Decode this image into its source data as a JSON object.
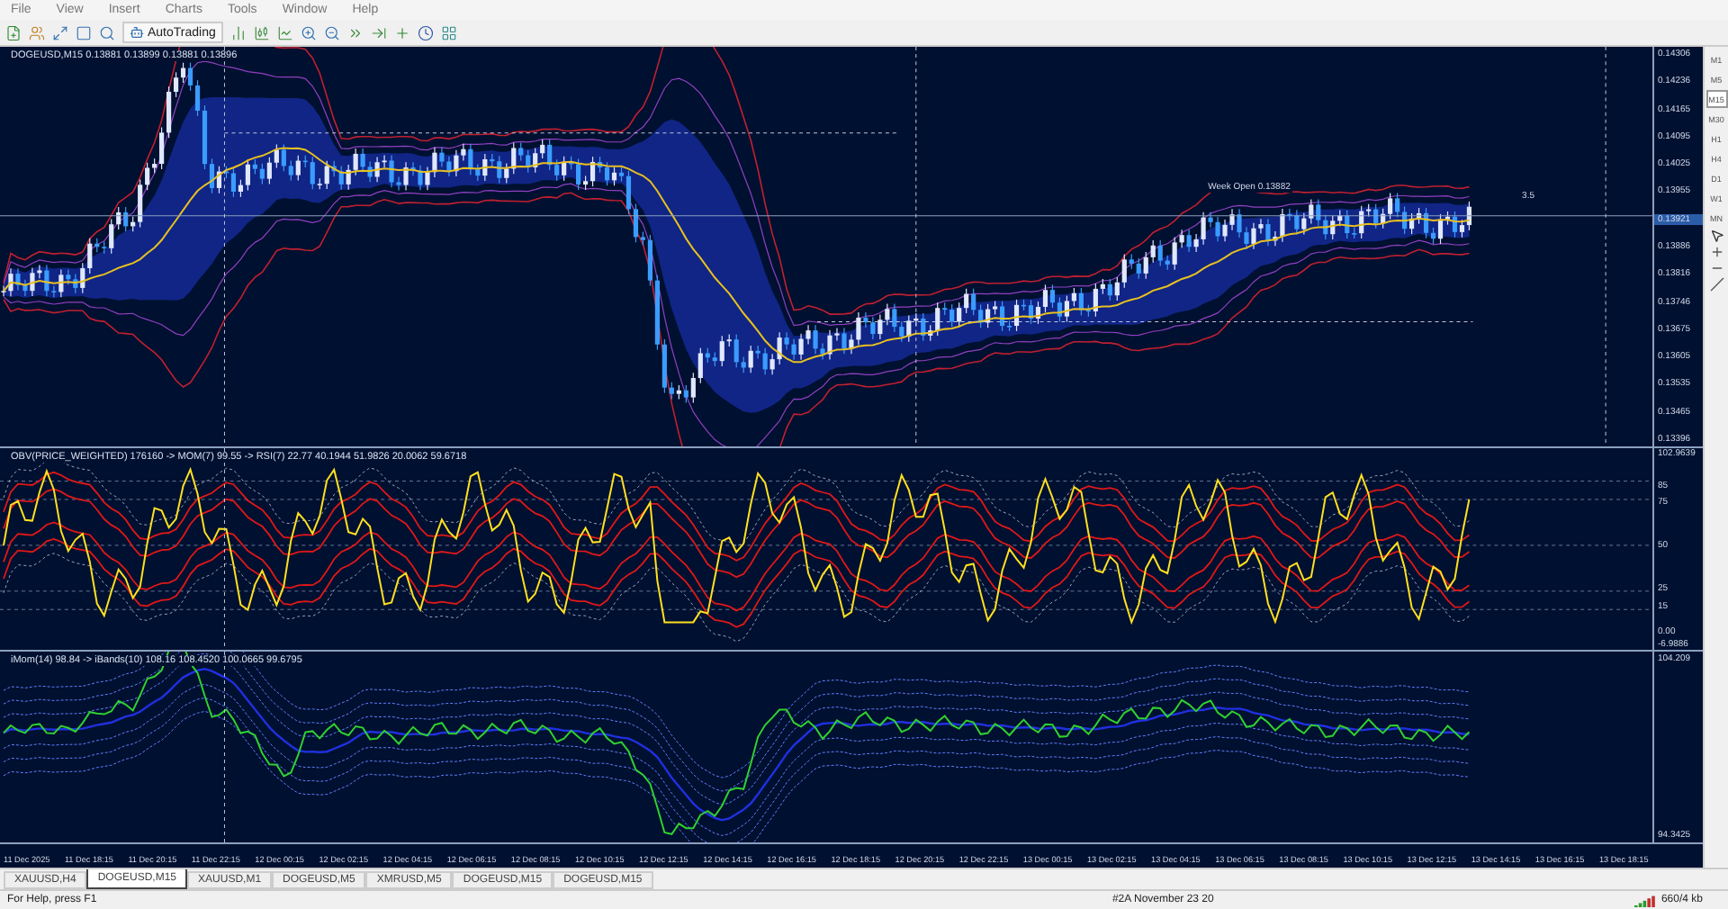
{
  "menu": [
    "File",
    "View",
    "Insert",
    "Charts",
    "Tools",
    "Window",
    "Help"
  ],
  "toolbar": {
    "autotrading": "AutoTrading"
  },
  "main_chart": {
    "header": "DOGEUSD,M15  0.13881 0.13899 0.13881 0.13896",
    "week_open_label": "Week Open 0.13882",
    "level_label": "3.5",
    "price_axis": [
      {
        "label": "0.14306",
        "kind": "tick"
      },
      {
        "label": "0.14236",
        "kind": "tick"
      },
      {
        "label": "0.14165",
        "kind": "tick"
      },
      {
        "label": "0.14095",
        "kind": "tick"
      },
      {
        "label": "0.14025",
        "kind": "tick"
      },
      {
        "label": "0.13955",
        "kind": "tick"
      },
      {
        "label": "0.13921",
        "kind": "current"
      },
      {
        "label": "0.13886",
        "kind": "tick"
      },
      {
        "label": "0.13816",
        "kind": "tick"
      },
      {
        "label": "0.13746",
        "kind": "tick"
      },
      {
        "label": "0.13675",
        "kind": "tick"
      },
      {
        "label": "0.13605",
        "kind": "tick"
      },
      {
        "label": "0.13535",
        "kind": "tick"
      },
      {
        "label": "0.13465",
        "kind": "tick"
      },
      {
        "label": "0.13396",
        "kind": "tick"
      }
    ]
  },
  "oscillator_pane": {
    "header": "OBV(PRICE_WEIGHTED) 176160 -> MOM(7) 99.55 -> RSI(7) 22.77  40.1944 51.9826 20.0062 59.6718",
    "axis": [
      "102.9639",
      "85",
      "75",
      "50",
      "25",
      "15",
      "0.00",
      "-6.9886"
    ]
  },
  "momentum_pane": {
    "header": "iMom(14) 98.84 -> iBands(10) 108.16  108.4520 100.0665 99.6795",
    "axis": [
      "104.209",
      "94.3425"
    ]
  },
  "time_axis": [
    "11 Dec 2025",
    "11 Dec 18:15",
    "11 Dec 20:15",
    "11 Dec 22:15",
    "12 Dec 00:15",
    "12 Dec 02:15",
    "12 Dec 04:15",
    "12 Dec 06:15",
    "12 Dec 08:15",
    "12 Dec 10:15",
    "12 Dec 12:15",
    "12 Dec 14:15",
    "12 Dec 16:15",
    "12 Dec 18:15",
    "12 Dec 20:15",
    "12 Dec 22:15",
    "13 Dec 00:15",
    "13 Dec 02:15",
    "13 Dec 04:15",
    "13 Dec 06:15",
    "13 Dec 08:15",
    "13 Dec 10:15",
    "13 Dec 12:15",
    "13 Dec 14:15",
    "13 Dec 16:15",
    "13 Dec 18:15"
  ],
  "timeframes": [
    {
      "label": "M1",
      "selected": false
    },
    {
      "label": "M5",
      "selected": false
    },
    {
      "label": "M15",
      "selected": true
    },
    {
      "label": "M30",
      "selected": false
    },
    {
      "label": "H1",
      "selected": false
    },
    {
      "label": "H4",
      "selected": false
    },
    {
      "label": "D1",
      "selected": false
    },
    {
      "label": "W1",
      "selected": false
    },
    {
      "label": "MN",
      "selected": false
    }
  ],
  "tabs": [
    {
      "label": "XAUUSD,H4",
      "selected": false
    },
    {
      "label": "DOGEUSD,M15",
      "selected": true
    },
    {
      "label": "XAUUSD,M1",
      "selected": false
    },
    {
      "label": "DOGEUSD,M5",
      "selected": false
    },
    {
      "label": "XMRUSD,M5",
      "selected": false
    },
    {
      "label": "DOGEUSD,M15",
      "selected": false
    },
    {
      "label": "DOGEUSD,M15",
      "selected": false
    }
  ],
  "status_bar": {
    "help": "For Help, press F1",
    "profile": "#2A November 23 20",
    "traffic": "660/4 kb"
  }
}
